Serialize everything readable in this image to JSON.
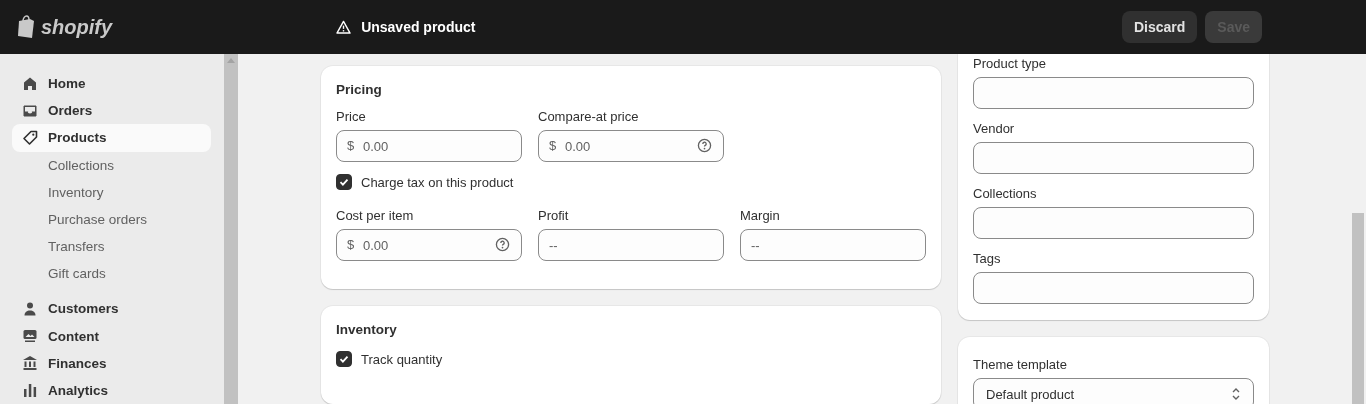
{
  "topbar": {
    "logo": "shopify",
    "title": "Unsaved product",
    "buttons": [
      {
        "label": "Discard",
        "disabled": false
      },
      {
        "label": "Save",
        "disabled": true
      }
    ]
  },
  "sidebar": {
    "items": [
      {
        "label": "Home",
        "selected": false
      },
      {
        "label": "Orders",
        "selected": false
      },
      {
        "label": "Products",
        "selected": true,
        "children": [
          {
            "label": "Collections",
            "selected": false
          },
          {
            "label": "Inventory",
            "selected": false
          },
          {
            "label": "Purchase orders",
            "selected": false
          },
          {
            "label": "Transfers",
            "selected": false
          },
          {
            "label": "Gift cards",
            "selected": false
          }
        ]
      },
      {
        "label": "Customers",
        "selected": false
      },
      {
        "label": "Content",
        "selected": false
      },
      {
        "label": "Finances",
        "selected": false
      },
      {
        "label": "Analytics",
        "selected": false
      }
    ]
  },
  "pricing": {
    "title": "Pricing",
    "rows": [
      {
        "fields": [
          {
            "label": "Price",
            "prefix": "$",
            "placeholder": "0.00",
            "help": false
          },
          {
            "label": "Compare-at price",
            "prefix": "$",
            "placeholder": "0.00",
            "help": true
          }
        ]
      },
      {
        "checkbox": {
          "label": "Charge tax on this product",
          "checked": true
        }
      },
      {
        "fields": [
          {
            "label": "Cost per item",
            "prefix": "$",
            "placeholder": "0.00",
            "help": true
          },
          {
            "label": "Profit",
            "placeholder": "--",
            "help": false
          },
          {
            "label": "Margin",
            "placeholder": "--",
            "help": false
          }
        ]
      }
    ]
  },
  "inventory": {
    "title": "Inventory",
    "checkbox": {
      "label": "Track quantity",
      "checked": true
    }
  },
  "organization": {
    "fields": [
      {
        "label": "Product type"
      },
      {
        "label": "Vendor"
      },
      {
        "label": "Collections"
      },
      {
        "label": "Tags"
      }
    ]
  },
  "theme": {
    "label": "Theme template",
    "value": "Default product"
  }
}
